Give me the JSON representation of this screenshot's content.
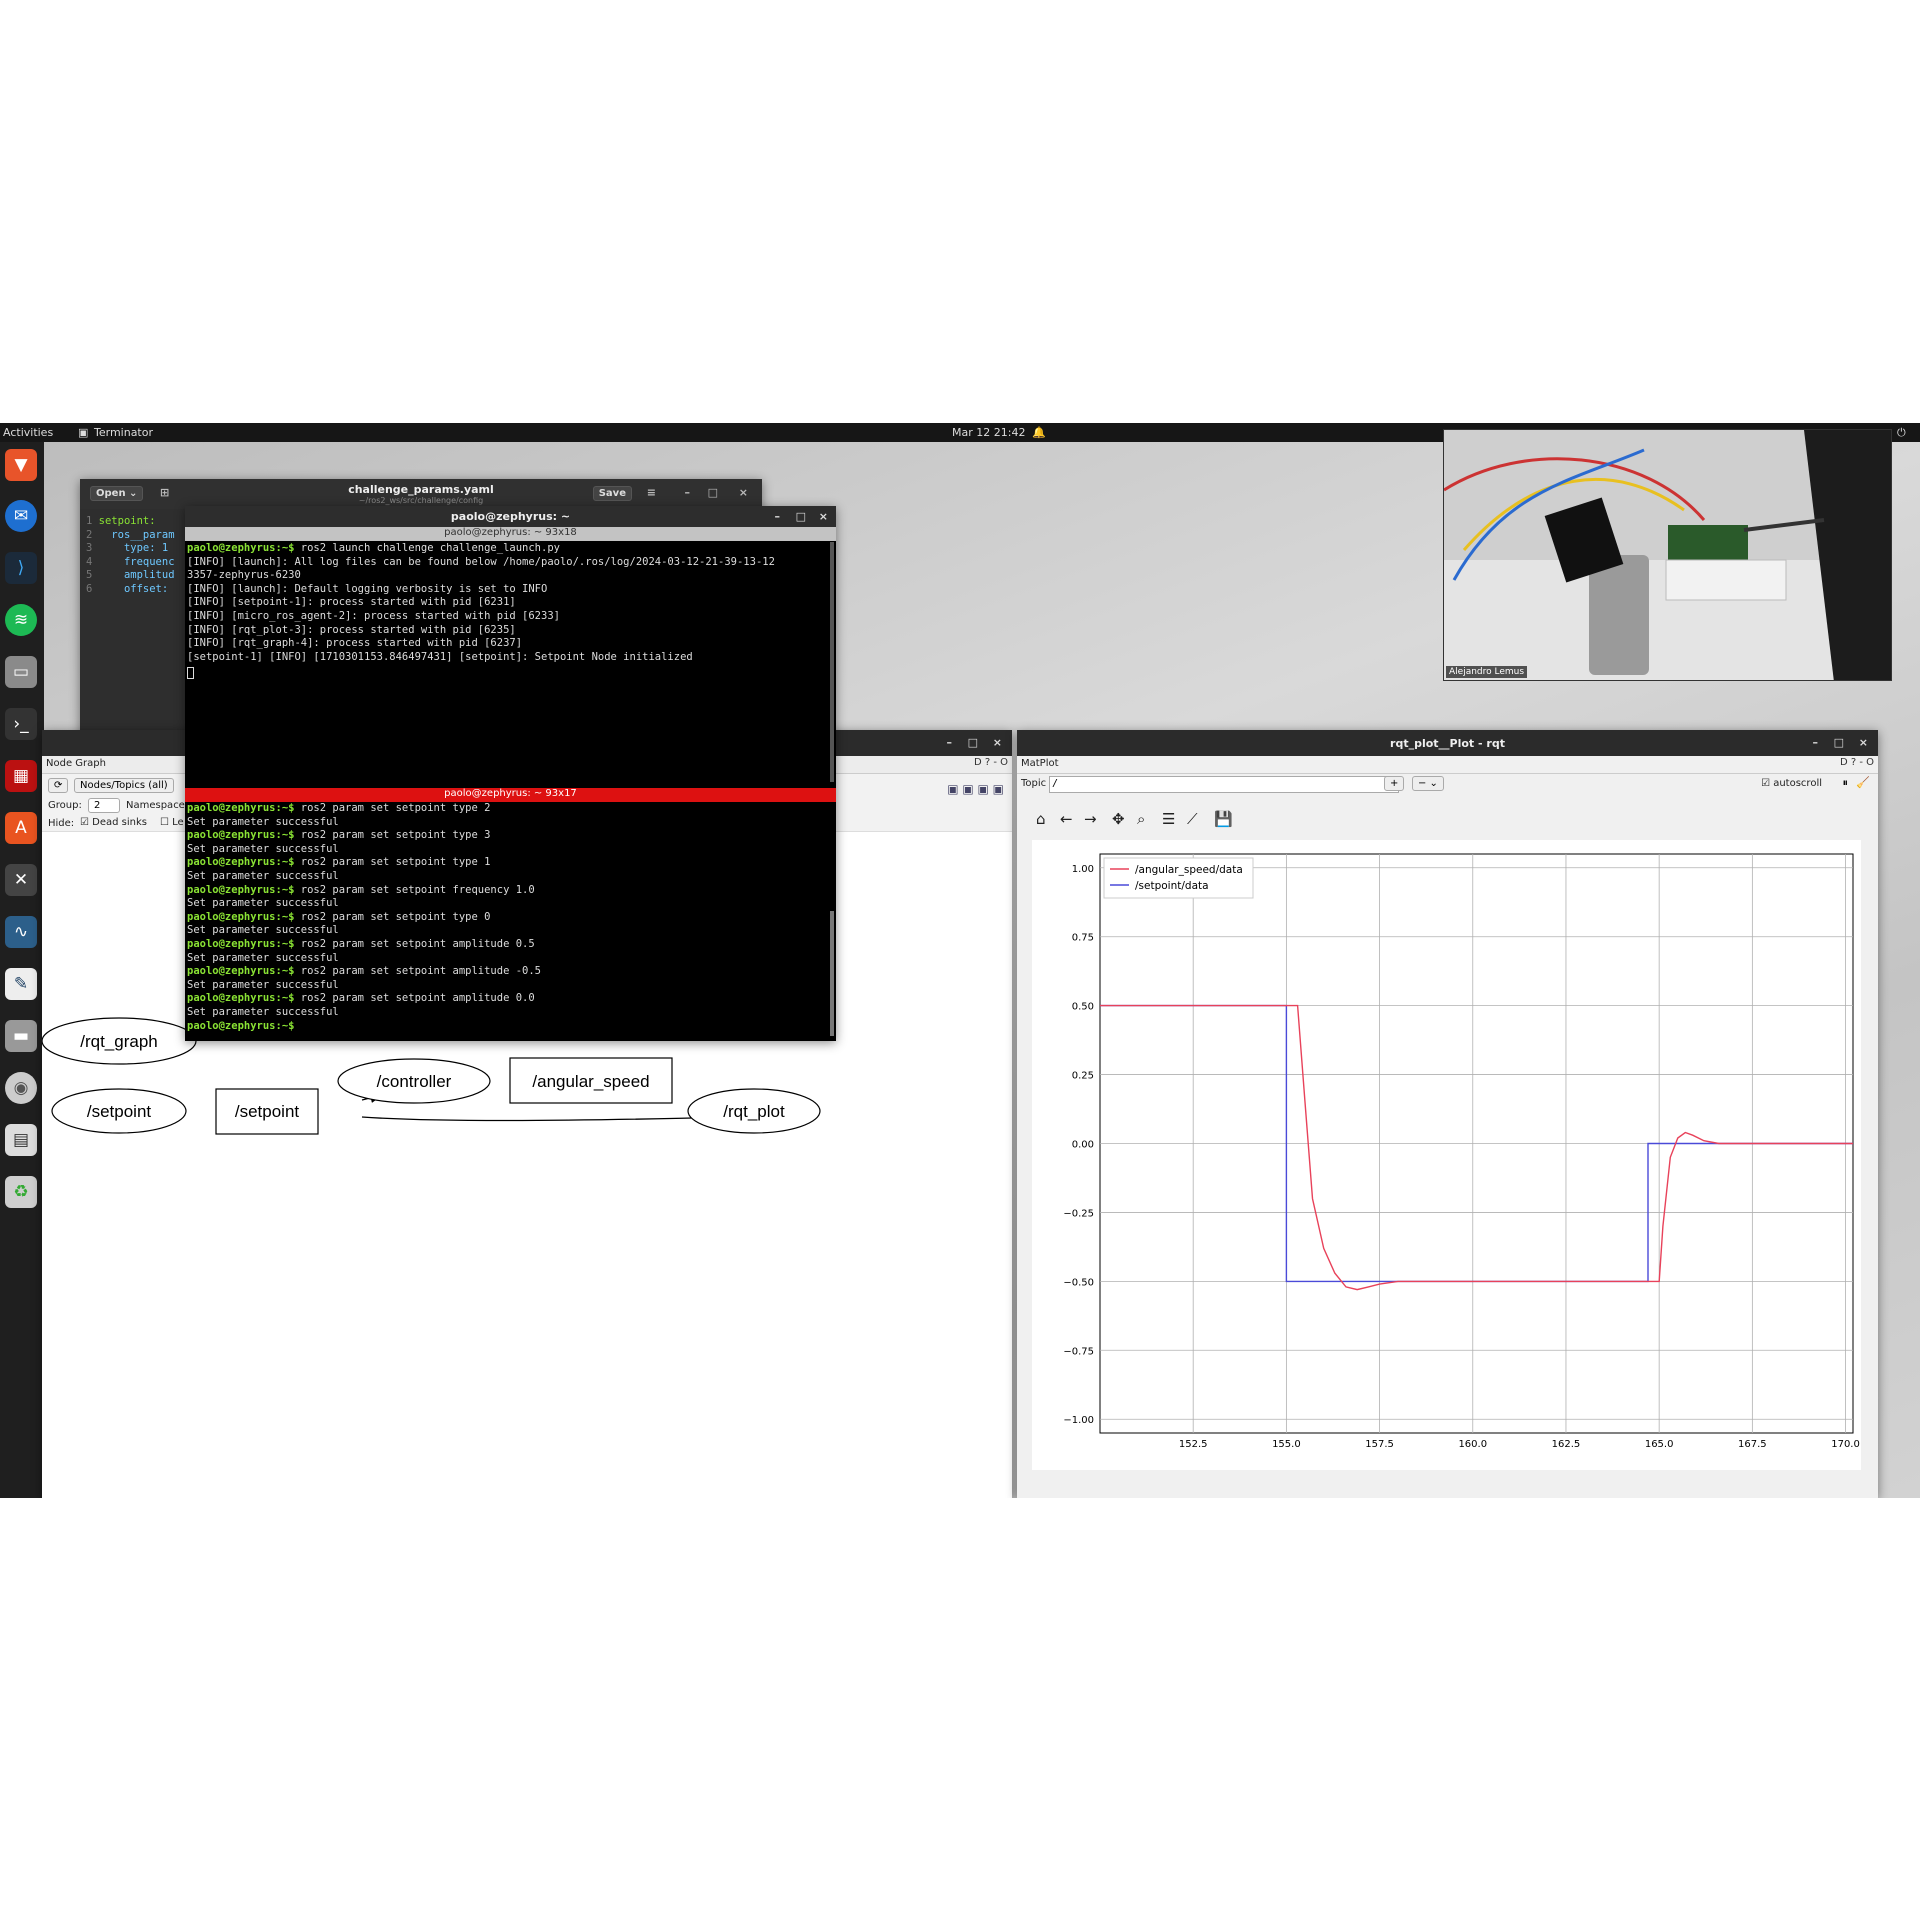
{
  "topbar": {
    "activities": "Activities",
    "app": "Terminator",
    "clock": "Mar 12  21:42"
  },
  "editor": {
    "title": "challenge_params.yaml",
    "subtitle": "~/ros2_ws/src/challenge/config",
    "open": "Open",
    "save": "Save",
    "lines": [
      {
        "no": "1",
        "text": "setpoint:"
      },
      {
        "no": "2",
        "text": "  ros__param"
      },
      {
        "no": "3",
        "text": "    type: 1"
      },
      {
        "no": "4",
        "text": "    frequenc"
      },
      {
        "no": "5",
        "text": "    amplitud"
      },
      {
        "no": "6",
        "text": "    offset: "
      }
    ]
  },
  "terminal": {
    "title": "paolo@zephyrus: ~",
    "pane1_title": "paolo@zephyrus: ~ 93x18",
    "pane2_title": "paolo@zephyrus: ~ 93x17",
    "prompt": "paolo@zephyrus:~$",
    "pane1": [
      {
        "p": "paolo@zephyrus:~$",
        "t": " ros2 launch challenge challenge_launch.py"
      },
      {
        "p": "",
        "t": "[INFO] [launch]: All log files can be found below /home/paolo/.ros/log/2024-03-12-21-39-13-12"
      },
      {
        "p": "",
        "t": "3357-zephyrus-6230"
      },
      {
        "p": "",
        "t": "[INFO] [launch]: Default logging verbosity is set to INFO"
      },
      {
        "p": "",
        "t": "[INFO] [setpoint-1]: process started with pid [6231]"
      },
      {
        "p": "",
        "t": "[INFO] [micro_ros_agent-2]: process started with pid [6233]"
      },
      {
        "p": "",
        "t": "[INFO] [rqt_plot-3]: process started with pid [6235]"
      },
      {
        "p": "",
        "t": "[INFO] [rqt_graph-4]: process started with pid [6237]"
      },
      {
        "p": "",
        "t": "[setpoint-1] [INFO] [1710301153.846497431] [setpoint]: Setpoint Node initialized"
      }
    ],
    "pane2": [
      {
        "p": "paolo@zephyrus:~$",
        "t": " ros2 param set setpoint type 2"
      },
      {
        "p": "",
        "t": "Set parameter successful"
      },
      {
        "p": "paolo@zephyrus:~$",
        "t": " ros2 param set setpoint type 3"
      },
      {
        "p": "",
        "t": "Set parameter successful"
      },
      {
        "p": "paolo@zephyrus:~$",
        "t": " ros2 param set setpoint type 1"
      },
      {
        "p": "",
        "t": "Set parameter successful"
      },
      {
        "p": "paolo@zephyrus:~$",
        "t": " ros2 param set setpoint frequency 1.0"
      },
      {
        "p": "",
        "t": "Set parameter successful"
      },
      {
        "p": "paolo@zephyrus:~$",
        "t": " ros2 param set setpoint type 0"
      },
      {
        "p": "",
        "t": "Set parameter successful"
      },
      {
        "p": "paolo@zephyrus:~$",
        "t": " ros2 param set setpoint amplitude 0.5"
      },
      {
        "p": "",
        "t": "Set parameter successful"
      },
      {
        "p": "paolo@zephyrus:~$",
        "t": " ros2 param set setpoint amplitude -0.5"
      },
      {
        "p": "",
        "t": "Set parameter successful"
      },
      {
        "p": "paolo@zephyrus:~$",
        "t": " ros2 param set setpoint amplitude 0.0"
      },
      {
        "p": "",
        "t": "Set parameter successful"
      },
      {
        "p": "paolo@zephyrus:~$",
        "t": ""
      }
    ]
  },
  "nodegraph": {
    "title": "Node Graph",
    "combo": "Nodes/Topics (all)",
    "group_label": "Group:",
    "group_value": "2",
    "namespace_label": "Namespace",
    "hide_label": "Hide:",
    "dead_sinks": "Dead sinks",
    "leaf": "Le",
    "nodes": {
      "rqt_graph": "/rqt_graph",
      "setpoint_node": "/setpoint",
      "setpoint_topic": "/setpoint",
      "controller": "/controller",
      "angular_speed": "/angular_speed",
      "rqt_plot": "/rqt_plot"
    }
  },
  "plot": {
    "title": "rqt_plot__Plot - rqt",
    "panel": "MatPlot",
    "topic_label": "Topic",
    "topic_value": "/",
    "autoscroll": "autoscroll",
    "toolbar_icons": [
      "home-icon",
      "back-icon",
      "forward-icon",
      "pan-icon",
      "zoom-icon",
      "configure-icon",
      "axes-edit-icon",
      "save-icon"
    ]
  },
  "chart_data": {
    "type": "line",
    "title": "",
    "xlabel": "",
    "ylabel": "",
    "xlim": [
      150.0,
      170.2
    ],
    "ylim": [
      -1.05,
      1.05
    ],
    "xticks": [
      "152.5",
      "155.0",
      "157.5",
      "160.0",
      "162.5",
      "165.0",
      "167.5",
      "170.0"
    ],
    "yticks": [
      "1.00",
      "0.75",
      "0.50",
      "0.25",
      "0.00",
      "−0.25",
      "−0.50",
      "−0.75",
      "−1.00"
    ],
    "grid": true,
    "legend_position": "top-left",
    "series": [
      {
        "name": "/angular_speed/data",
        "color": "#e8425a",
        "x": [
          150.0,
          155.3,
          155.5,
          155.7,
          156.0,
          156.3,
          156.6,
          156.9,
          157.2,
          157.5,
          158,
          160,
          162,
          164.6,
          165.0,
          165.1,
          165.3,
          165.5,
          165.7,
          165.9,
          166.2,
          166.6,
          167,
          170.2
        ],
        "y": [
          0.5,
          0.5,
          0.15,
          -0.2,
          -0.38,
          -0.47,
          -0.52,
          -0.53,
          -0.52,
          -0.51,
          -0.5,
          -0.5,
          -0.5,
          -0.5,
          -0.5,
          -0.3,
          -0.05,
          0.02,
          0.04,
          0.03,
          0.01,
          0.0,
          0.0,
          0.0
        ]
      },
      {
        "name": "/setpoint/data",
        "color": "#4a4ad8",
        "x": [
          150.0,
          155.0,
          155.0,
          164.7,
          164.7,
          170.2
        ],
        "y": [
          0.5,
          0.5,
          -0.5,
          -0.5,
          0.0,
          0.0
        ]
      }
    ]
  },
  "video": {
    "label": "Alejandro Lemus"
  }
}
